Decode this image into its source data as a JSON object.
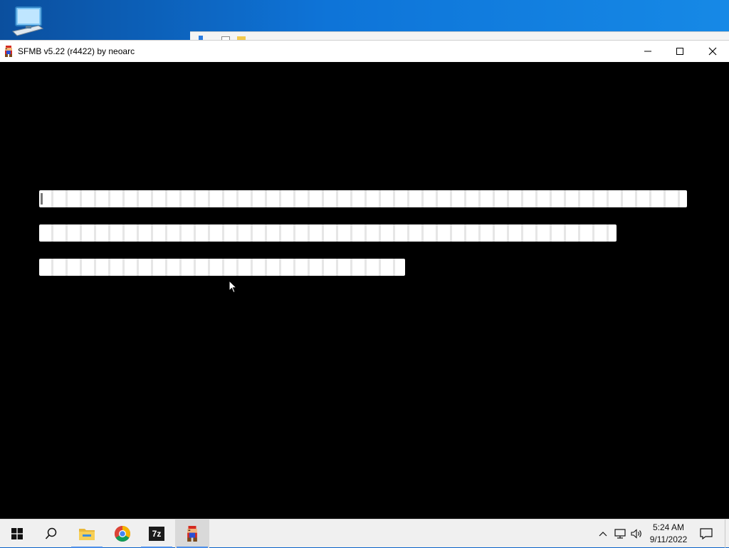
{
  "window": {
    "title": "SFMB v5.22 (r4422) by neoarc",
    "controls": {
      "minimize": "minimize",
      "maximize": "maximize",
      "close": "close"
    }
  },
  "icons": {
    "desktop": "this-pc-icon",
    "app": "mario-icon",
    "taskbar": [
      "windows-start-icon",
      "search-icon",
      "file-explorer-icon",
      "chrome-icon",
      "7zip-icon",
      "mario-icon"
    ],
    "tray": [
      "chevron-up-icon",
      "network-icon",
      "volume-icon",
      "notification-icon"
    ]
  },
  "taskbar": {
    "sevenz_label": "7z",
    "time": "5:24 AM",
    "date": "9/11/2022"
  },
  "colors": {
    "window_background": "#000000",
    "input_bar": "#ffffff",
    "taskbar": "#f0f0f0",
    "accent": "#4c8ee8"
  }
}
